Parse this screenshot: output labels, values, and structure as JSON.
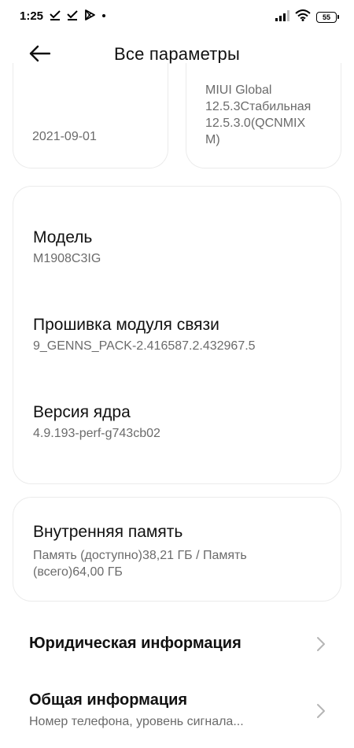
{
  "status_bar": {
    "time": "1:25",
    "battery_level": "55",
    "left_icons": [
      "check-icon",
      "check-icon",
      "play-store-icon",
      "dot-icon"
    ],
    "right_icons": [
      "signal-icon",
      "wifi-icon",
      "battery-icon"
    ]
  },
  "header": {
    "title": "Все параметры",
    "back_icon": "arrow-left-icon"
  },
  "partial_cards": {
    "left": {
      "value": "2021-09-01"
    },
    "right": {
      "lines": [
        "MIUI Global",
        "12.5.3Стабильная",
        "12.5.3.0(QCNMIX",
        "M)"
      ]
    }
  },
  "device_info": {
    "items": [
      {
        "title": "Модель",
        "value": "M1908C3IG"
      },
      {
        "title": "Прошивка модуля связи",
        "value": "9_GENNS_PACK-2.416587.2.432967.5"
      },
      {
        "title": "Версия ядра",
        "value": "4.9.193-perf-g743cb02"
      }
    ]
  },
  "storage": {
    "title": "Внутренняя память",
    "value": "Память (доступно)38,21 ГБ / Память (всего)64,00 ГБ"
  },
  "list": [
    {
      "title": "Юридическая информация",
      "subtitle": ""
    },
    {
      "title": "Общая информация",
      "subtitle": "Номер телефона, уровень сигнала..."
    }
  ],
  "colors": {
    "text_primary": "#111111",
    "text_secondary": "#6b6b6b",
    "card_border": "#ebebeb",
    "background": "#ffffff"
  }
}
